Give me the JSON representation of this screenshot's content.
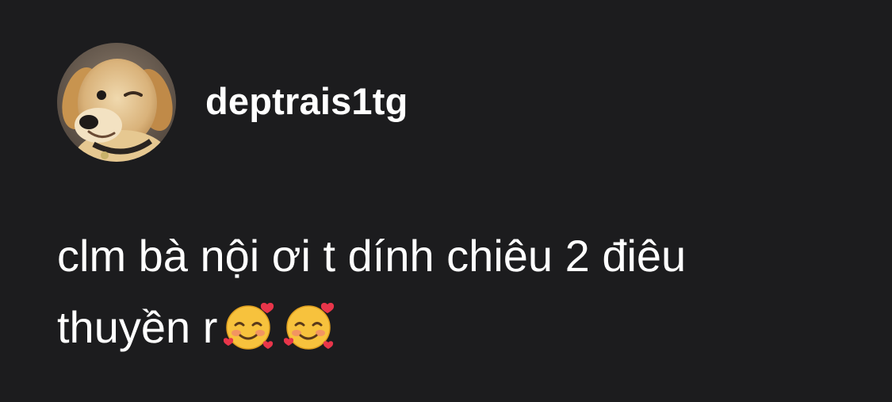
{
  "post": {
    "username": "deptrais1tg",
    "avatar_icon": "golden-retriever-puppy-photo",
    "text_line_1": "clm bà nội ơi t dính chiêu 2 điêu",
    "text_line_2": "thuyền r",
    "emojis": [
      "smiling-face-with-hearts-emoji",
      "smiling-face-with-hearts-emoji"
    ]
  },
  "colors": {
    "background": "#1c1c1e",
    "text": "#ffffff"
  }
}
